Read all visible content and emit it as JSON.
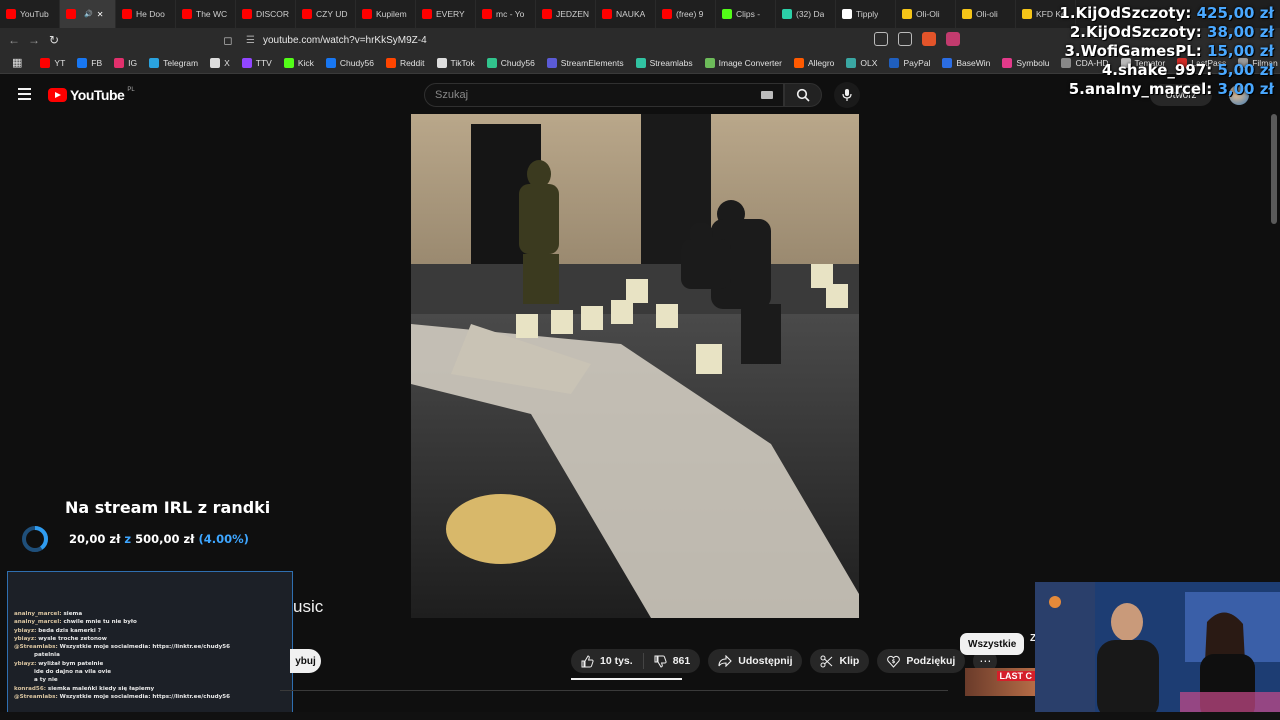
{
  "browser": {
    "tabs": [
      {
        "label": "YouTub",
        "color": "#ff0000"
      },
      {
        "label": "",
        "color": "#ff0000",
        "active": true
      },
      {
        "label": "He Doo",
        "color": "#ff0000"
      },
      {
        "label": "The WC",
        "color": "#ff0000"
      },
      {
        "label": "DISCOR",
        "color": "#ff0000"
      },
      {
        "label": "CZY UD",
        "color": "#ff0000"
      },
      {
        "label": "Kupilem",
        "color": "#ff0000"
      },
      {
        "label": "EVERY",
        "color": "#ff0000"
      },
      {
        "label": "mc - Yo",
        "color": "#ff0000"
      },
      {
        "label": "JEDZEN",
        "color": "#ff0000"
      },
      {
        "label": "NAUKA",
        "color": "#ff0000"
      },
      {
        "label": "(free) 9",
        "color": "#ff0000"
      },
      {
        "label": "Clips -",
        "color": "#53fc18"
      },
      {
        "label": "(32) Da",
        "color": "#2bd0a8"
      },
      {
        "label": "Tipply",
        "color": "#ffffff"
      },
      {
        "label": "Oli-Oli",
        "color": "#f5c518"
      },
      {
        "label": "Oli-oli",
        "color": "#f5c518"
      },
      {
        "label": "KFD Ke",
        "color": "#f5c518"
      }
    ],
    "url": "youtube.com/watch?v=hrKkSyM9Z-4",
    "bookmarks": [
      {
        "label": "YT",
        "color": "#ff0000"
      },
      {
        "label": "FB",
        "color": "#1877f2"
      },
      {
        "label": "IG",
        "color": "#e1306c"
      },
      {
        "label": "Telegram",
        "color": "#2aa3df"
      },
      {
        "label": "X",
        "color": "#dddddd"
      },
      {
        "label": "TTV",
        "color": "#9146ff"
      },
      {
        "label": "Kick",
        "color": "#53fc18"
      },
      {
        "label": "Chudy56",
        "color": "#1877f2"
      },
      {
        "label": "Reddit",
        "color": "#ff4500"
      },
      {
        "label": "TikTok",
        "color": "#dddddd"
      },
      {
        "label": "Chudy56",
        "color": "#31c48d"
      },
      {
        "label": "StreamElements",
        "color": "#5b5bd6"
      },
      {
        "label": "Streamlabs",
        "color": "#31c3a2"
      },
      {
        "label": "Image Converter",
        "color": "#6dbb5a"
      },
      {
        "label": "Allegro",
        "color": "#ff5a00"
      },
      {
        "label": "OLX",
        "color": "#3aa7a3"
      },
      {
        "label": "PayPal",
        "color": "#1f5fbf"
      },
      {
        "label": "BaseWin",
        "color": "#2b6de3"
      },
      {
        "label": "Symbolu",
        "color": "#e33a8a"
      },
      {
        "label": "CDA-HD",
        "color": "#888888"
      },
      {
        "label": "Temator",
        "color": "#bbbbbb"
      },
      {
        "label": "LastPass",
        "color": "#d32d27"
      },
      {
        "label": "Filman",
        "color": "#999999"
      }
    ]
  },
  "youtube": {
    "logo_text": "YouTube",
    "country_code": "PL",
    "search_placeholder": "Szukaj",
    "create_label": "Utwórz",
    "title_fragment": "usic",
    "subscribe_fragment": "ybuj",
    "likes": "10 tys.",
    "dislikes": "861",
    "share_label": "Udostępnij",
    "clip_label": "Klip",
    "thanks_label": "Podziękuj",
    "chip_all": "Wszystkie",
    "chip_second": "Z",
    "thumb_tag": "LAST C"
  },
  "overlay": {
    "leaderboard": [
      {
        "name": "1.KijOdSzczoty:",
        "amount": "425,00 zł"
      },
      {
        "name": "2.KijOdSzczoty:",
        "amount": "38,00 zł"
      },
      {
        "name": "3.WofiGamesPL:",
        "amount": "15,00 zł"
      },
      {
        "name": "4.shake_997:",
        "amount": "5,00 zł"
      },
      {
        "name": "5.analny_marcel:",
        "amount": "3,00 zł"
      }
    ],
    "goal": {
      "title": "Na stream IRL z randki",
      "current": "20,00 zł",
      "sep": "z",
      "target": "500,00 zł",
      "percent": "(4.00%)",
      "progress": 0.04
    },
    "chat": [
      {
        "user": "analny_marcel:",
        "msg": "siema"
      },
      {
        "user": "analny_marcel:",
        "msg": "chwile mnie tu nie było"
      },
      {
        "user": "ybiayz:",
        "msg": "beda dzis kamerki ?"
      },
      {
        "user": "ybiayz:",
        "msg": "wysle troche zetonow"
      },
      {
        "user": "@Streamlabs:",
        "msg": "Wszystkie moje socialmedia: https://linktr.ee/chudy56"
      },
      {
        "user": "",
        "msg": "patelnia"
      },
      {
        "user": "ybiayz:",
        "msg": "wyliżał bym patelnie"
      },
      {
        "user": "",
        "msg": "ide do dajno na vila ovie"
      },
      {
        "user": "",
        "msg": "a ty nie"
      },
      {
        "user": "konrad56:",
        "msg": "siemka maleńki kiedy się łapiemy"
      },
      {
        "user": "@Streamlabs:",
        "msg": "Wszystkie moje socialmedia: https://linktr.ee/chudy56"
      }
    ]
  }
}
